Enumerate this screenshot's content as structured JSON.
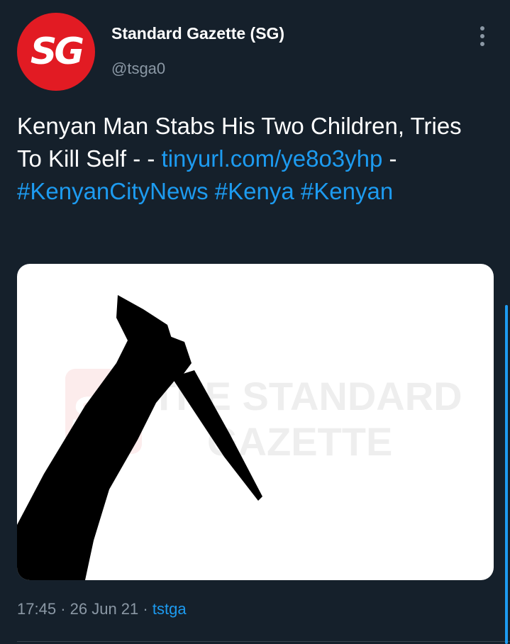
{
  "tweet": {
    "author": {
      "display_name": "Standard Gazette (SG)",
      "handle": "@tsga0",
      "avatar_text": "SG",
      "avatar_color": "#e21b23"
    },
    "text": {
      "plain": "Kenyan Man Stabs His Two Children, Tries To Kill Self -  -",
      "link": "tinyurl.com/ye8o3yhp",
      "separator": "-",
      "hashtags": [
        "#KenyanCityNews",
        "#Kenya",
        "#Kenyan"
      ]
    },
    "media": {
      "watermark_logo": "SG",
      "watermark_line1": "THE STANDARD",
      "watermark_line2": "GAZETTE"
    },
    "time": "17:45",
    "date": "26 Jun 21",
    "source": "tstga",
    "dot": "·"
  },
  "colors": {
    "background": "#15202b",
    "link": "#1d9bf0",
    "muted": "#8b98a5"
  },
  "icons": {
    "more": "vertical-ellipsis-icon"
  }
}
